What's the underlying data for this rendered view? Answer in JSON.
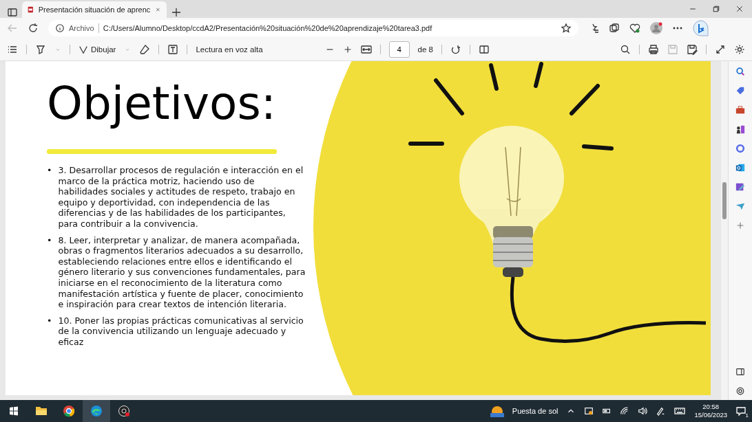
{
  "browser_tab": {
    "title": "Presentación situación de aprenc"
  },
  "address_bar": {
    "label": "Archivo",
    "url": "C:/Users/Alumno/Desktop/ccdA2/Presentación%20situación%20de%20aprendizaje%20tarea3.pdf"
  },
  "pdf_toolbar": {
    "draw_label": "Dibujar",
    "read_aloud": "Lectura en voz alta",
    "page": "4",
    "page_total": "de 8"
  },
  "slide": {
    "title": "Objetivos:",
    "bullets": [
      {
        "marker": "•",
        "text": "3. Desarrollar procesos de regulación e interacción en el marco de la práctica motriz, haciendo uso de habilidades sociales y actitudes de respeto, trabajo en equipo y deportividad, con independencia de las diferencias y de las habilidades de los participantes, para contribuir a la convivencia."
      },
      {
        "marker": "•",
        "text": "8. Leer, interpretar y analizar, de manera acompañada, obras o fragmentos literarios adecuados a su desarrollo, estableciendo relaciones entre ellos e identificando el género literario y sus convenciones fundamentales, para iniciarse en el reconocimiento de la literatura como manifestación artística y fuente de placer, conocimiento e inspiración para crear textos de intención literaria."
      },
      {
        "marker": "•",
        "text": "10. Poner las propias prácticas comunicativas al servicio de la convivencia utilizando un lenguaje adecuado y eficaz"
      }
    ]
  },
  "taskbar": {
    "weather": "Puesta de sol",
    "time": "20:58",
    "date": "15/06/2023",
    "notifications": "1"
  }
}
